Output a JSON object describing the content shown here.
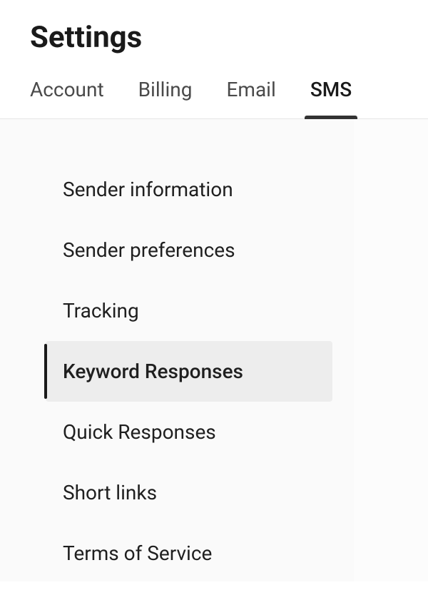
{
  "header": {
    "title": "Settings"
  },
  "tabs": [
    {
      "label": "Account",
      "active": false
    },
    {
      "label": "Billing",
      "active": false
    },
    {
      "label": "Email",
      "active": false
    },
    {
      "label": "SMS",
      "active": true
    }
  ],
  "sidebar": {
    "items": [
      {
        "label": "Sender information",
        "active": false
      },
      {
        "label": "Sender preferences",
        "active": false
      },
      {
        "label": "Tracking",
        "active": false
      },
      {
        "label": "Keyword Responses",
        "active": true
      },
      {
        "label": "Quick Responses",
        "active": false
      },
      {
        "label": "Short links",
        "active": false
      },
      {
        "label": "Terms of Service",
        "active": false
      }
    ]
  }
}
